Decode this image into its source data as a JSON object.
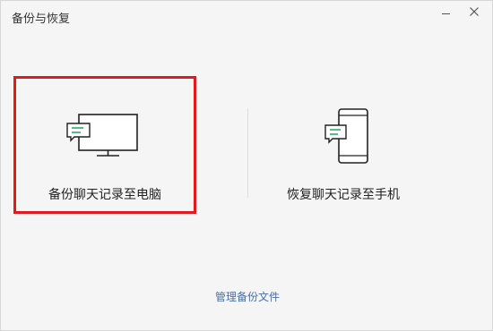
{
  "window": {
    "title": "备份与恢复"
  },
  "options": [
    {
      "label": "备份聊天记录至电脑",
      "icon": "computer-chat-icon",
      "highlighted": true
    },
    {
      "label": "恢复聊天记录至手机",
      "icon": "phone-chat-icon",
      "highlighted": false
    }
  ],
  "footer": {
    "manage_link": "管理备份文件"
  },
  "colors": {
    "accent_green": "#2aae67",
    "highlight_red": "#e21a1a",
    "link_blue": "#4a6ea8"
  }
}
